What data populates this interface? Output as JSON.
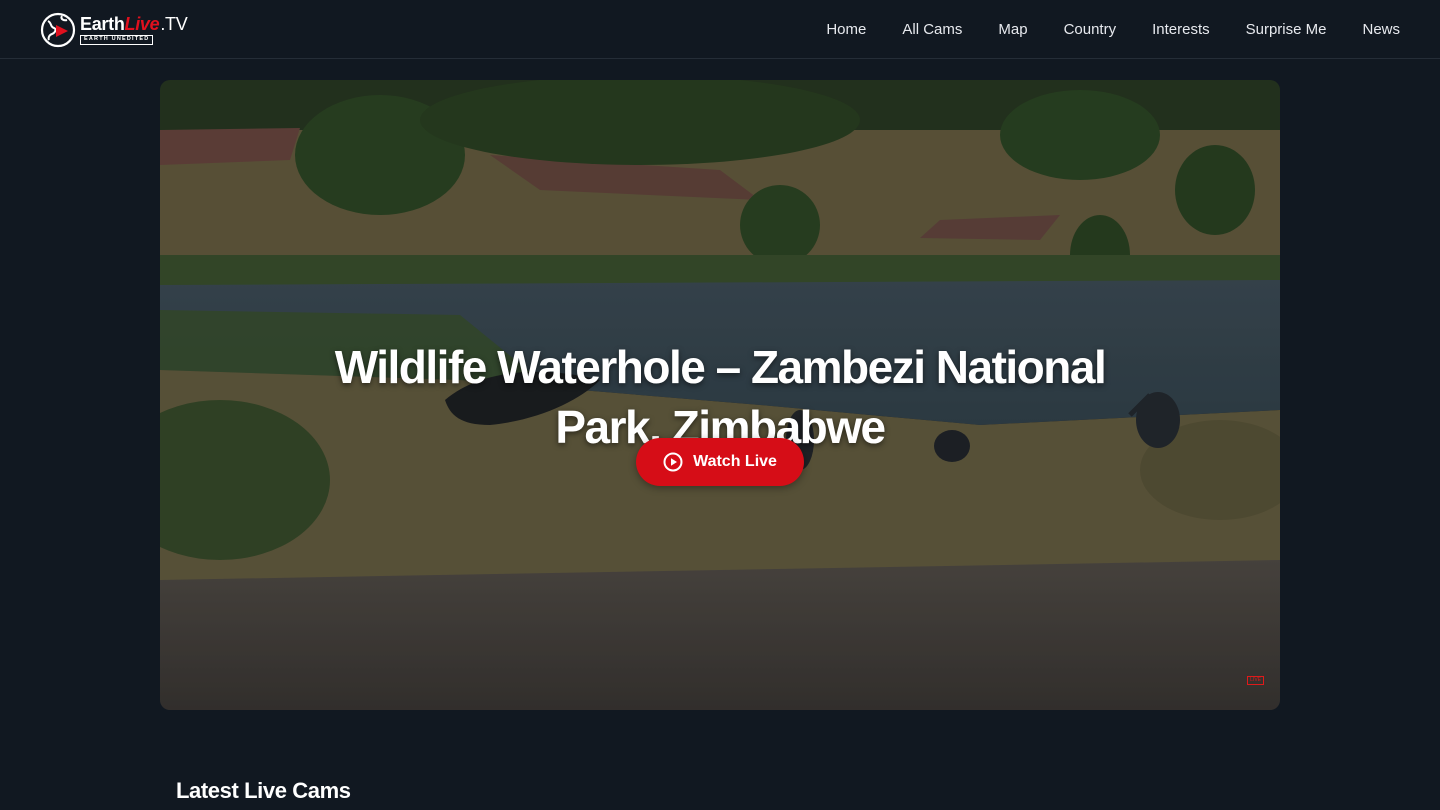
{
  "brand": {
    "name_part1": "Earth",
    "name_part2": "Live",
    "name_part3": ".TV",
    "tagline": "EARTH UNEDITED"
  },
  "nav": {
    "items": [
      {
        "label": "Home"
      },
      {
        "label": "All Cams"
      },
      {
        "label": "Map"
      },
      {
        "label": "Country"
      },
      {
        "label": "Interests"
      },
      {
        "label": "Surprise Me"
      },
      {
        "label": "News"
      }
    ]
  },
  "hero": {
    "title": "Wildlife Waterhole – Zambezi National Park, Zimbabwe",
    "watch_label": "Watch Live",
    "badge": "LIVE"
  },
  "sections": {
    "latest_title": "Latest Live Cams"
  },
  "colors": {
    "background": "#111821",
    "accent": "#d60d17"
  },
  "icons": {
    "logo": "globe-play-icon",
    "watch": "play-circle-icon"
  }
}
